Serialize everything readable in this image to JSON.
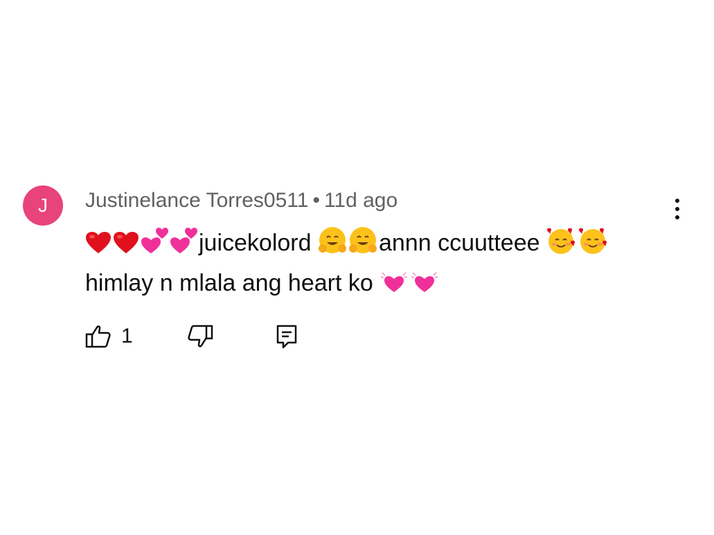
{
  "comment": {
    "avatar_letter": "J",
    "avatar_color": "#e8437a",
    "author": "Justinelance Torres0511",
    "separator": "•",
    "timestamp": "11d ago",
    "line1_text_a": "juicekolord ",
    "line1_text_b": "annn ccuutteee ",
    "line2_text": "himlay n mlala ang heart ko ",
    "emojis": [
      "red-heart",
      "red-heart",
      "two-hearts",
      "two-hearts",
      "hugging-face",
      "hugging-face",
      "smiling-face-with-hearts",
      "smiling-face-with-hearts",
      "beating-heart",
      "beating-heart"
    ],
    "like_count": "1"
  },
  "icons": {
    "menu": "more-vertical-icon",
    "like": "thumbs-up-icon",
    "dislike": "thumbs-down-icon",
    "reply": "reply-comment-icon"
  }
}
